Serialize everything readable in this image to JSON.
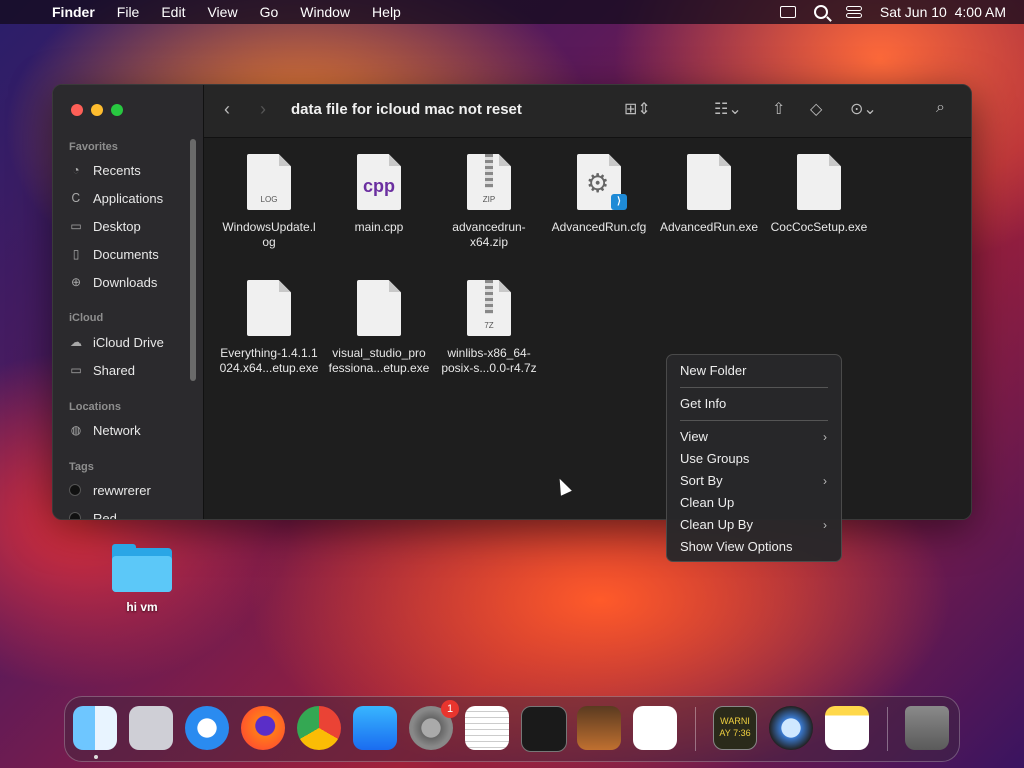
{
  "menubar": {
    "app": "Finder",
    "menus": [
      "File",
      "Edit",
      "View",
      "Go",
      "Window",
      "Help"
    ],
    "datetime": "Sat Jun 10  4:00 AM"
  },
  "window": {
    "title": "data file for icloud mac not reset",
    "sidebar": {
      "favorites_header": "Favorites",
      "favorites": [
        {
          "label": "Recents",
          "icon": "clock-icon"
        },
        {
          "label": "Applications",
          "icon": "applications-icon"
        },
        {
          "label": "Desktop",
          "icon": "desktop-icon"
        },
        {
          "label": "Documents",
          "icon": "document-icon"
        },
        {
          "label": "Downloads",
          "icon": "download-icon"
        }
      ],
      "icloud_header": "iCloud",
      "icloud": [
        {
          "label": "iCloud Drive",
          "icon": "cloud-icon"
        },
        {
          "label": "Shared",
          "icon": "shared-folder-icon"
        }
      ],
      "locations_header": "Locations",
      "locations": [
        {
          "label": "Network",
          "icon": "globe-icon"
        }
      ],
      "tags_header": "Tags",
      "tags": [
        {
          "label": "rewwrerer"
        },
        {
          "label": "Red"
        }
      ]
    },
    "files": [
      {
        "name": "WindowsUpdate.log",
        "line1": "WindowsUpdate.l",
        "line2": "og",
        "kind": "LOG"
      },
      {
        "name": "main.cpp",
        "line1": "main.cpp",
        "line2": "",
        "kind": "cpp"
      },
      {
        "name": "advancedrun-x64.zip",
        "line1": "advancedrun-",
        "line2": "x64.zip",
        "kind": "ZIP"
      },
      {
        "name": "AdvancedRun.cfg",
        "line1": "AdvancedRun.cfg",
        "line2": "",
        "kind": "cfg"
      },
      {
        "name": "AdvancedRun.exe",
        "line1": "AdvancedRun.exe",
        "line2": "",
        "kind": ""
      },
      {
        "name": "CocCocSetup.exe",
        "line1": "CocCocSetup.exe",
        "line2": "",
        "kind": ""
      },
      {
        "name": "Everything-1.4.1.1024.x64...etup.exe",
        "line1": "Everything-1.4.1.1",
        "line2": "024.x64...etup.exe",
        "kind": ""
      },
      {
        "name": "visual_studio_professiona...etup.exe",
        "line1": "visual_studio_pro",
        "line2": "fessiona...etup.exe",
        "kind": ""
      },
      {
        "name": "winlibs-x86_64-posix-s...0.0-r4.7z",
        "line1": "winlibs-x86_64-",
        "line2": "posix-s...0.0-r4.7z",
        "kind": "7Z"
      }
    ]
  },
  "context_menu": {
    "new_folder": "New Folder",
    "get_info": "Get Info",
    "view": "View",
    "use_groups": "Use Groups",
    "sort_by": "Sort By",
    "clean_up": "Clean Up",
    "clean_up_by": "Clean Up By",
    "show_view_options": "Show View Options"
  },
  "desktop": {
    "folder_label": "hi vm"
  },
  "dock": {
    "items": [
      "Finder",
      "Launchpad",
      "Safari",
      "Firefox",
      "Chrome",
      "App Store",
      "System Settings",
      "TextEdit",
      "Terminal",
      "GarageBand",
      "Visual Studio Code",
      "Console",
      "QuickTime",
      "Notes",
      "Trash"
    ],
    "settings_badge": "1",
    "console_text": "WARNI\nAY 7:36"
  }
}
